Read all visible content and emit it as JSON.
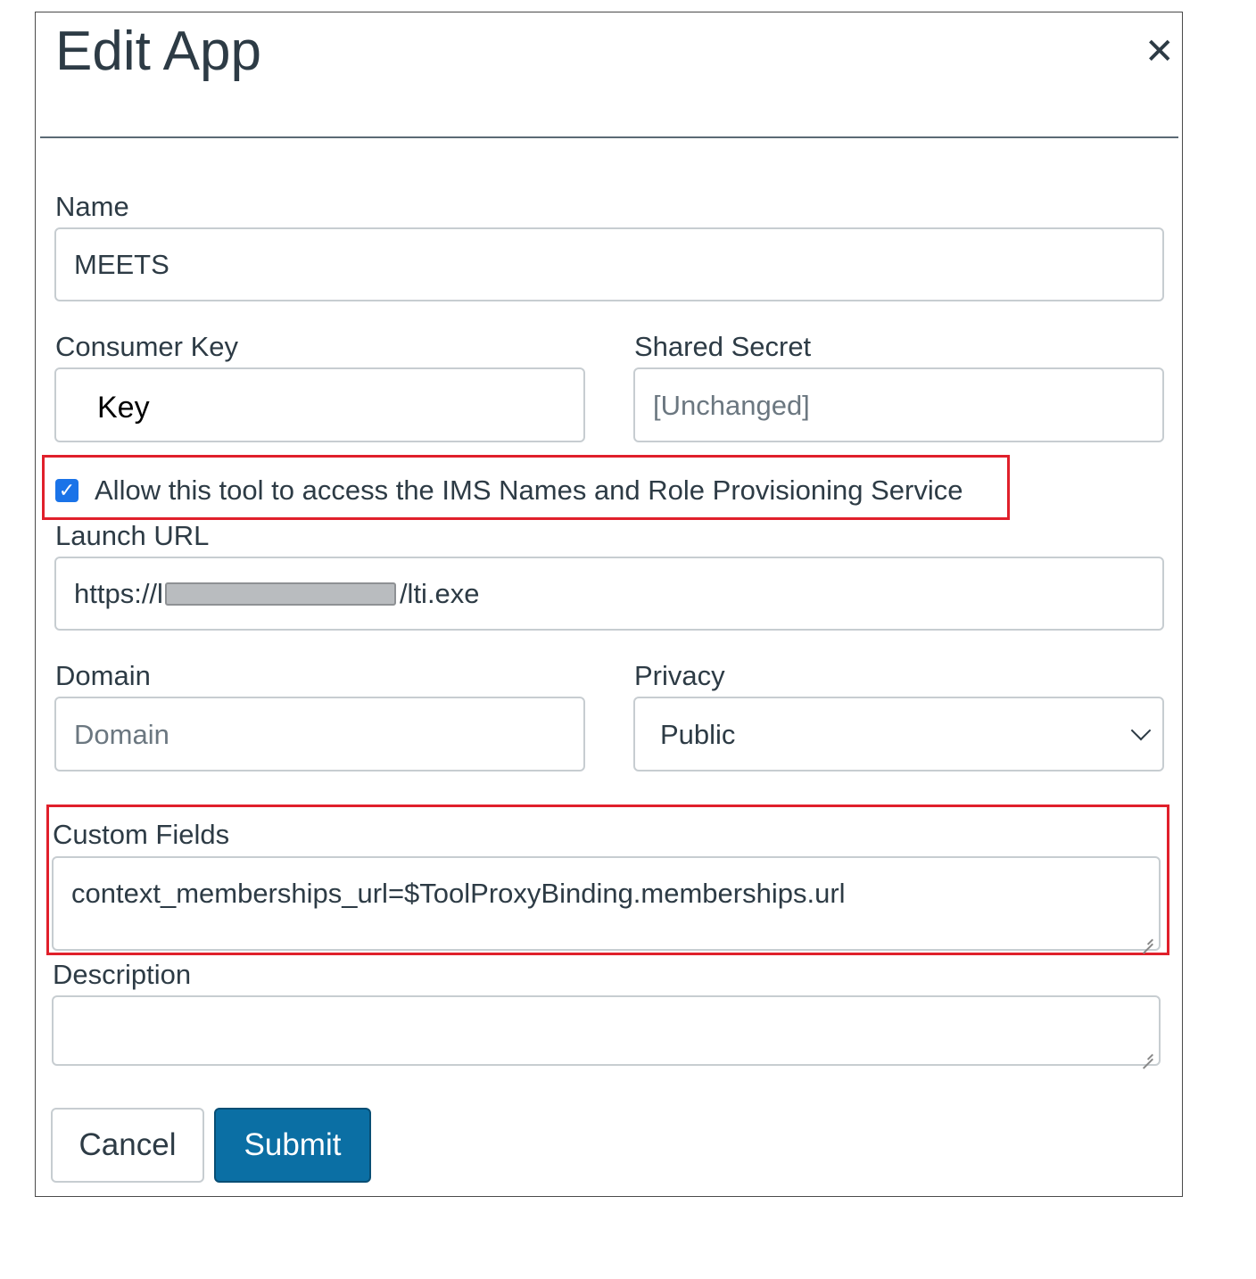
{
  "dialog": {
    "title": "Edit App",
    "close_icon": "close-icon"
  },
  "form": {
    "name": {
      "label": "Name",
      "value": "MEETS"
    },
    "consumer_key": {
      "label": "Consumer Key",
      "value": "Key"
    },
    "shared_secret": {
      "label": "Shared Secret",
      "placeholder": "[Unchanged]"
    },
    "ims_checkbox": {
      "checked": true,
      "label": "Allow this tool to access the IMS Names and Role Provisioning Service"
    },
    "launch_url": {
      "label": "Launch URL",
      "value_prefix": "https://l",
      "value_suffix": "/lti.exe"
    },
    "domain": {
      "label": "Domain",
      "placeholder": "Domain"
    },
    "privacy": {
      "label": "Privacy",
      "selected": "Public"
    },
    "custom_fields": {
      "label": "Custom Fields",
      "value": "context_memberships_url=$ToolProxyBinding.memberships.url"
    },
    "description": {
      "label": "Description",
      "value": ""
    }
  },
  "buttons": {
    "cancel": "Cancel",
    "submit": "Submit"
  },
  "colors": {
    "submit_bg": "#0b6fa4",
    "highlight": "#e0202b",
    "checkbox": "#1a73e8"
  }
}
